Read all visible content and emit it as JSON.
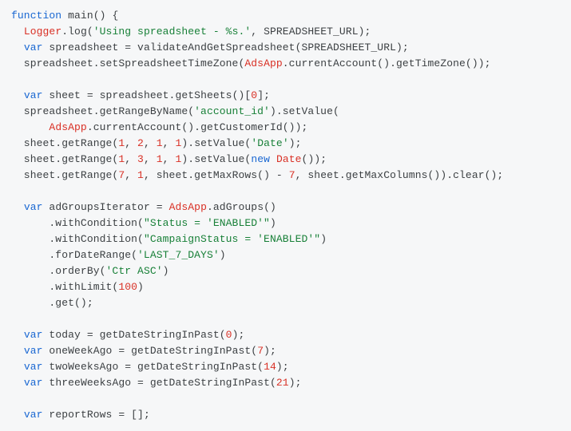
{
  "code": {
    "l1": {
      "kw": "function",
      "name": " main",
      "p": "() {"
    },
    "l2a": "  ",
    "l2type": "Logger",
    "l2b": ".log(",
    "l2s": "'Using spreadsheet - %s.'",
    "l2c": ", SPREADSHEET_URL);",
    "l3": {
      "kw": "var",
      "rest": " spreadsheet = validateAndGetSpreadsheet(SPREADSHEET_URL);"
    },
    "l4a": "  spreadsheet.setSpreadsheetTimeZone(",
    "l4type": "AdsApp",
    "l4b": ".currentAccount().getTimeZone());",
    "l6": {
      "kw": "var",
      "a": " sheet = spreadsheet.getSheets()[",
      "n": "0",
      "b": "];"
    },
    "l7a": "  spreadsheet.getRangeByName(",
    "l7s": "'account_id'",
    "l7b": ").setValue(",
    "l8a": "      ",
    "l8type": "AdsApp",
    "l8b": ".currentAccount().getCustomerId());",
    "l9": {
      "a": "  sheet.getRange(",
      "n1": "1",
      "n2": "2",
      "n3": "1",
      "n4": "1",
      "b": ").setValue(",
      "s": "'Date'",
      "c": ");"
    },
    "l10": {
      "a": "  sheet.getRange(",
      "n1": "1",
      "n2": "3",
      "n3": "1",
      "n4": "1",
      "b": ").setValue(",
      "kw": "new",
      "type": "Date",
      "c": "());"
    },
    "l11": {
      "a": "  sheet.getRange(",
      "n1": "7",
      "n2": "1",
      "b": ", sheet.getMaxRows() - ",
      "n3": "7",
      "c": ", sheet.getMaxColumns()).clear();"
    },
    "l13": {
      "kw": "var",
      "a": " adGroupsIterator = ",
      "type": "AdsApp",
      "b": ".adGroups()"
    },
    "l14": {
      "a": "      .withCondition(",
      "s": "\"Status = 'ENABLED'\"",
      "b": ")"
    },
    "l15": {
      "a": "      .withCondition(",
      "s": "\"CampaignStatus = 'ENABLED'\"",
      "b": ")"
    },
    "l16": {
      "a": "      .forDateRange(",
      "s": "'LAST_7_DAYS'",
      "b": ")"
    },
    "l17": {
      "a": "      .orderBy(",
      "s": "'Ctr ASC'",
      "b": ")"
    },
    "l18": {
      "a": "      .withLimit(",
      "n": "100",
      "b": ")"
    },
    "l19": "      .get();",
    "l21": {
      "kw": "var",
      "a": " today = getDateStringInPast(",
      "n": "0",
      "b": ");"
    },
    "l22": {
      "kw": "var",
      "a": " oneWeekAgo = getDateStringInPast(",
      "n": "7",
      "b": ");"
    },
    "l23": {
      "kw": "var",
      "a": " twoWeeksAgo = getDateStringInPast(",
      "n": "14",
      "b": ");"
    },
    "l24": {
      "kw": "var",
      "a": " threeWeeksAgo = getDateStringInPast(",
      "n": "21",
      "b": ");"
    },
    "l26": {
      "kw": "var",
      "a": " reportRows = [];"
    }
  }
}
